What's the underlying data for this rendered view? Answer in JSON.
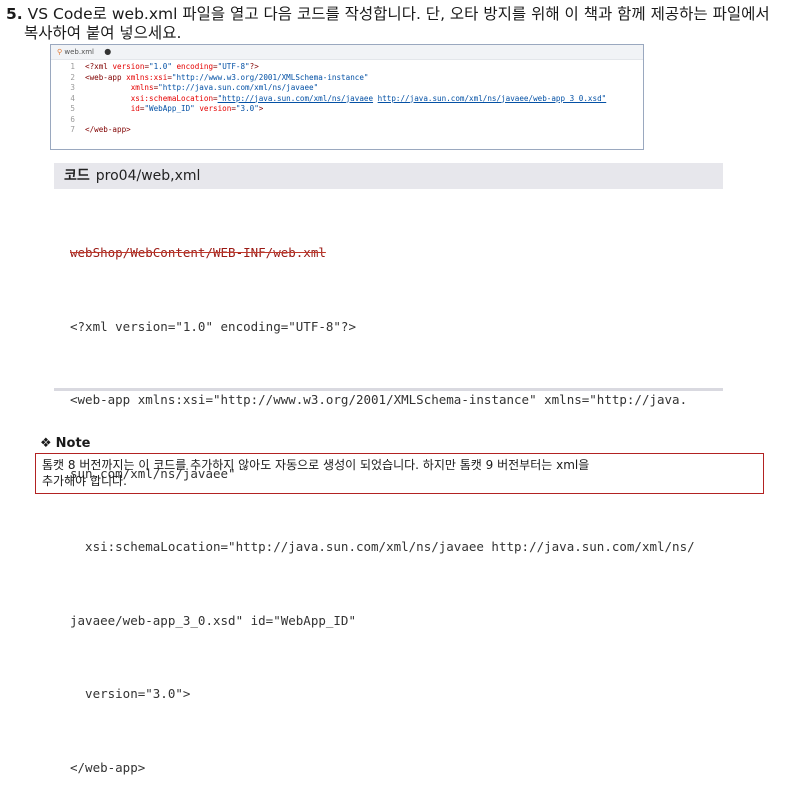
{
  "step": {
    "number": "5.",
    "line1": "VS Code로 web.xml 파일을 열고 다음 코드를 작성합니다. 단, 오타 방지를 위해 이 책과 함께 제공하는 파일에서",
    "line2": "복사하여 붙여 넣으세요."
  },
  "editor": {
    "tab_label": "web.xml",
    "tab_dot": "●",
    "lines": [
      {
        "n": "1",
        "parts": [
          [
            "tx",
            "<?xml "
          ],
          [
            "at",
            "version"
          ],
          [
            "tx",
            "="
          ],
          [
            "st",
            "\"1.0\""
          ],
          [
            "tx",
            " "
          ],
          [
            "at",
            "encoding"
          ],
          [
            "tx",
            "="
          ],
          [
            "st",
            "\"UTF-8\""
          ],
          [
            "tx",
            "?>"
          ]
        ]
      },
      {
        "n": "2",
        "parts": [
          [
            "tx",
            "<web-app "
          ],
          [
            "at",
            "xmlns:xsi"
          ],
          [
            "tx",
            "="
          ],
          [
            "st",
            "\"http://www.w3.org/2001/XMLSchema-instance\""
          ]
        ]
      },
      {
        "n": "3",
        "parts": [
          [
            "tx",
            "          "
          ],
          [
            "at",
            "xmlns"
          ],
          [
            "tx",
            "="
          ],
          [
            "st",
            "\"http://java.sun.com/xml/ns/javaee\""
          ]
        ]
      },
      {
        "n": "4",
        "parts": [
          [
            "tx",
            "          "
          ],
          [
            "at",
            "xsi:schemaLocation"
          ],
          [
            "tx",
            "="
          ],
          [
            "stu",
            "\"http://java.sun.com/xml/ns/javaee"
          ],
          [
            "tx",
            " "
          ],
          [
            "stu",
            "http://java.sun.com/xml/ns/javaee/web-app_3_0.xsd\""
          ]
        ]
      },
      {
        "n": "5",
        "parts": [
          [
            "tx",
            "          "
          ],
          [
            "at",
            "id"
          ],
          [
            "tx",
            "="
          ],
          [
            "st",
            "\"WebApp_ID\""
          ],
          [
            "tx",
            " "
          ],
          [
            "at",
            "version"
          ],
          [
            "tx",
            "="
          ],
          [
            "st",
            "\"3.0\""
          ],
          [
            "tx",
            ">"
          ]
        ]
      },
      {
        "n": "6",
        "parts": []
      },
      {
        "n": "7",
        "parts": [
          [
            "tx",
            "</web-app>"
          ]
        ]
      }
    ]
  },
  "code_listing": {
    "header_label": "코드",
    "header_path": "pro04/web,xml",
    "struck_path": "webShop/WebContent/WEB-INF/web.xml",
    "lines": [
      "<?xml version=\"1.0\" encoding=\"UTF-8\"?>",
      "<web-app xmlns:xsi=\"http://www.w3.org/2001/XMLSchema-instance\" xmlns=\"http://java.",
      "sun.com/xml/ns/javaee\"",
      "  xsi:schemaLocation=\"http://java.sun.com/xml/ns/javaee http://java.sun.com/xml/ns/",
      "javaee/web-app_3_0.xsd\" id=\"WebApp_ID\"",
      "  version=\"3.0\">",
      "</web-app>"
    ]
  },
  "note": {
    "symbol": "❖",
    "title": "Note",
    "line1": "톰캣 8 버전까지는 이 코드를 추가하지 않아도 자동으로 생성이 되었습니다. 하지만 톰캣 9 버전부터는 xml을",
    "line2": "추가해야 합니다."
  },
  "colors": {
    "note_border": "#b22222",
    "header_bg": "#e7e7ec",
    "strike": "#c0392b"
  }
}
